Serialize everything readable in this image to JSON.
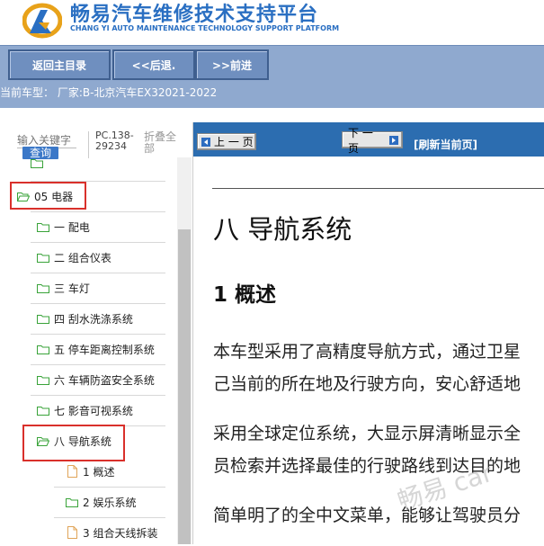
{
  "header": {
    "title_cn": "畅易汽车维修技术支持平台",
    "title_en": "CHANG YI AUTO MAINTENANCE TECHNOLOGY SUPPORT PLATFORM",
    "brand_color": "#2a6fc2"
  },
  "nav": {
    "home_label": "返回主目录",
    "back_label": "<<后退.",
    "forward_label": ">>前进"
  },
  "model_info": "当前车型： 厂家:B-北京汽车EX32021-2022",
  "sidebar": {
    "search_placeholder": "输入关键字",
    "query_label": "查询",
    "doc_code": "PC.138-29234",
    "collapse_label": "折叠全部",
    "tree": [
      {
        "label": "05 电器",
        "type": "folder",
        "highlighted": true
      },
      {
        "label": "一 配电",
        "type": "folder"
      },
      {
        "label": "二 组合仪表",
        "type": "folder"
      },
      {
        "label": "三 车灯",
        "type": "folder"
      },
      {
        "label": "四 刮水洗涤系统",
        "type": "folder"
      },
      {
        "label": "五 停车距离控制系统",
        "type": "folder"
      },
      {
        "label": "六 车辆防盗安全系统",
        "type": "folder"
      },
      {
        "label": "七 影音可视系统",
        "type": "folder"
      },
      {
        "label": "八 导航系统",
        "type": "folder",
        "highlighted": true
      },
      {
        "label": "1  概述",
        "type": "doc"
      },
      {
        "label": "2  娱乐系统",
        "type": "folder"
      },
      {
        "label": "3  组合天线拆装",
        "type": "doc"
      }
    ]
  },
  "content": {
    "prev_label": "上 一 页",
    "next_label": "下 一 页",
    "refresh_label": "[刷新当前页]",
    "section_title": "八 导航系统",
    "subsection_title": "1 概述",
    "paragraphs": [
      "本车型采用了高精度导航方式，通过卫星",
      "己当前的所在地及行驶方向，安心舒适地",
      "采用全球定位系统，大显示屏清晰显示全",
      "员检索并选择最佳的行驶路线到达目的地",
      "简单明了的全中文菜单，能够让驾驶员分"
    ]
  },
  "watermark": "畅易 car"
}
